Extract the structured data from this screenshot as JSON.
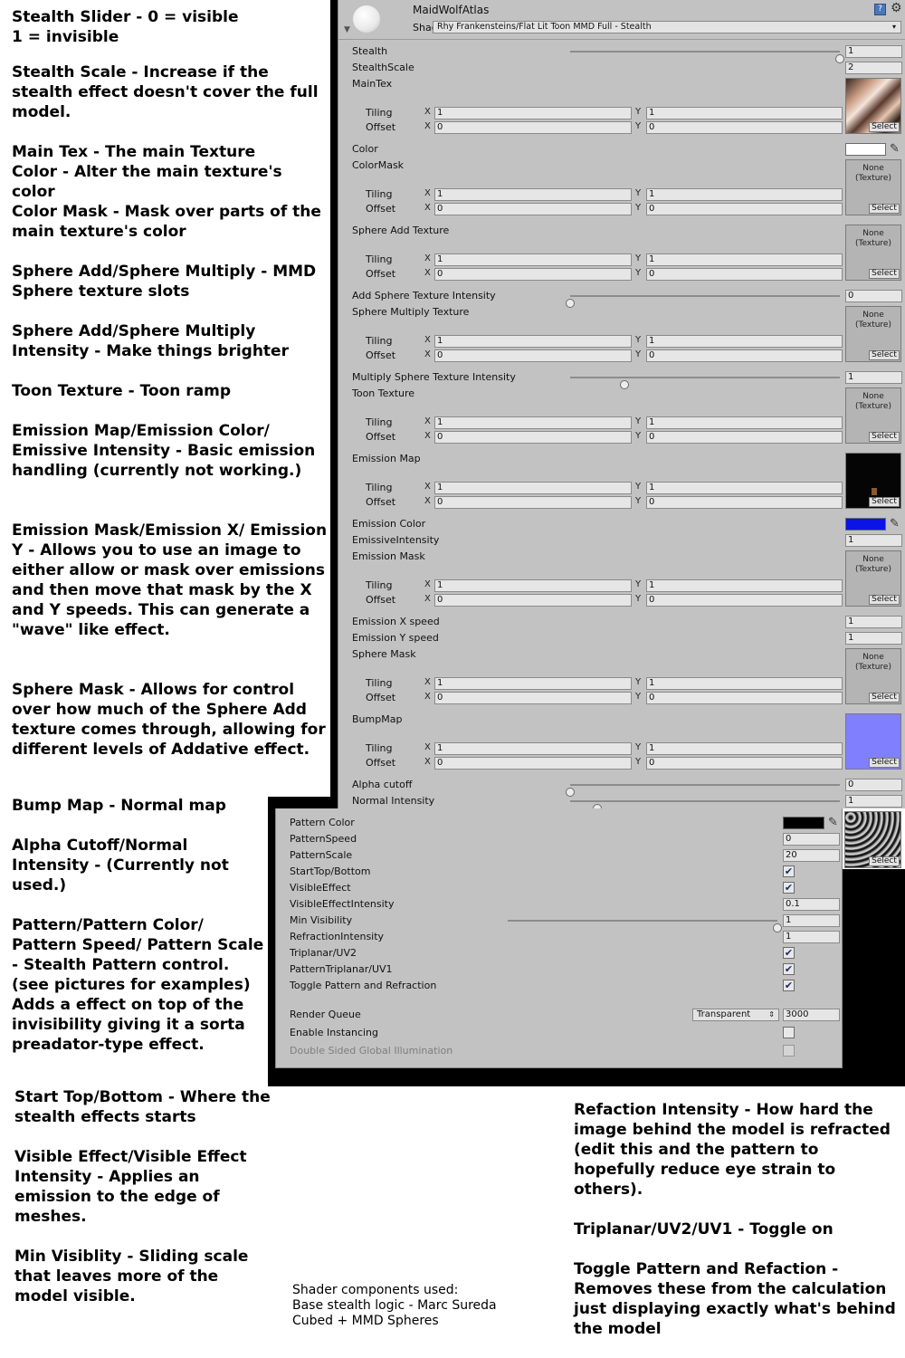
{
  "notes": {
    "n1": "Stealth Slider - 0 = visible\n                   1 = invisible",
    "n2": "Stealth Scale - Increase if the stealth effect doesn't cover the full model.",
    "n3": "Main Tex - The main Texture\nColor - Alter the main texture's\n            color\nColor Mask - Mask over parts of the main texture's color",
    "n4": "Sphere Add/Sphere Multiply - MMD Sphere texture slots",
    "n5": "Sphere Add/Sphere Multiply Intensity - Make things brighter",
    "n6": "Toon Texture - Toon ramp",
    "n7": "Emission Map/Emission Color/ Emissive Intensity - Basic emission handling (currently not working.)",
    "n8": "Emission Mask/Emission X/ Emission Y - Allows you to use an image to either allow or mask over emissions and then move that mask by the X and Y speeds.  This can generate a \"wave\" like effect.",
    "n9": "Sphere Mask - Allows for control over how much of the Sphere Add texture comes through, allowing for different levels of Addative effect.",
    "n10": "Bump Map - Normal map",
    "n11": "Alpha Cutoff/Normal Intensity - (Currently not used.)",
    "n12": "Pattern/Pattern Color/ Pattern Speed/ Pattern Scale - Stealth Pattern control. (see pictures for examples) Adds a effect on top of the invisibility giving it a sorta preadator-type effect.",
    "n13": "Start Top/Bottom - Where the stealth effects starts",
    "n14": "Visible Effect/Visible Effect Intensity - Applies an emission to the edge of meshes.",
    "n15": "Min Visiblity - Sliding scale that leaves more of the model visible.",
    "n16": "Refaction Intensity - How hard the image behind the model is refracted (edit this and the pattern to hopefully reduce eye strain to others).",
    "n17": "Triplanar/UV2/UV1 - Toggle on",
    "n18": "Toggle Pattern and Refaction - Removes these from the calculation just displaying exactly what's behind the model",
    "credits": "Shader components used:\nBase stealth logic - Marc Sureda\nCubed + MMD Spheres"
  },
  "inspector": {
    "material_name": "MaidWolfAtlas",
    "shader_label": "Shader",
    "shader_value": "Rhy Frankensteins/Flat Lit Toon MMD Full - Stealth",
    "help_icon": "book-help-icon",
    "gear_icon": "gear-icon",
    "tiling_label": "Tiling",
    "offset_label": "Offset",
    "x_label": "X",
    "y_label": "Y",
    "select_label": "Select",
    "none_texture": "None\n(Texture)",
    "stealth": {
      "label": "Stealth",
      "value": "1",
      "slider": 1
    },
    "stealth_scale": {
      "label": "StealthScale",
      "value": "2"
    },
    "main_tex": {
      "label": "MainTex",
      "tiling_x": "1",
      "tiling_y": "1",
      "offset_x": "0",
      "offset_y": "0"
    },
    "color": {
      "label": "Color",
      "swatch": "#ffffff"
    },
    "color_mask": {
      "label": "ColorMask",
      "tiling_x": "1",
      "tiling_y": "1",
      "offset_x": "0",
      "offset_y": "0"
    },
    "sphere_add": {
      "label": "Sphere Add Texture",
      "tiling_x": "1",
      "tiling_y": "1",
      "offset_x": "0",
      "offset_y": "0"
    },
    "add_sphere_intensity": {
      "label": "Add Sphere Texture Intensity",
      "value": "0",
      "slider": 0
    },
    "sphere_multiply": {
      "label": "Sphere Multiply Texture",
      "tiling_x": "1",
      "tiling_y": "1",
      "offset_x": "0",
      "offset_y": "0"
    },
    "multiply_sphere_intensity": {
      "label": "Multiply Sphere Texture Intensity",
      "value": "1",
      "slider": 0.2
    },
    "toon_texture": {
      "label": "Toon Texture",
      "tiling_x": "1",
      "tiling_y": "1",
      "offset_x": "0",
      "offset_y": "0"
    },
    "emission_map": {
      "label": "Emission Map",
      "tiling_x": "1",
      "tiling_y": "1",
      "offset_x": "0",
      "offset_y": "0"
    },
    "emission_color": {
      "label": "Emission Color",
      "swatch": "#0a14e6"
    },
    "emissive_intensity": {
      "label": "EmissiveIntensity",
      "value": "1"
    },
    "emission_mask": {
      "label": "Emission Mask",
      "tiling_x": "1",
      "tiling_y": "1",
      "offset_x": "0",
      "offset_y": "0"
    },
    "emission_x": {
      "label": "Emission X speed",
      "value": "1"
    },
    "emission_y": {
      "label": "Emission Y speed",
      "value": "1"
    },
    "sphere_mask": {
      "label": "Sphere Mask",
      "tiling_x": "1",
      "tiling_y": "1",
      "offset_x": "0",
      "offset_y": "0"
    },
    "bump_map": {
      "label": "BumpMap",
      "tiling_x": "1",
      "tiling_y": "1",
      "offset_x": "0",
      "offset_y": "0"
    },
    "alpha_cutoff": {
      "label": "Alpha cutoff",
      "value": "0",
      "slider": 0
    },
    "normal_intensity": {
      "label": "Normal Intensity",
      "value": "1",
      "slider": 0.1
    },
    "pattern_color": {
      "label": "Pattern Color",
      "swatch": "#000000"
    },
    "pattern_speed": {
      "label": "PatternSpeed",
      "value": "0"
    },
    "pattern_scale": {
      "label": "PatternScale",
      "value": "20"
    },
    "start_top_bottom": {
      "label": "StartTop/Bottom",
      "checked": true
    },
    "visible_effect": {
      "label": "VisibleEffect",
      "checked": true
    },
    "visible_effect_intensity": {
      "label": "VisibleEffectIntensity",
      "value": "0.1"
    },
    "min_visibility": {
      "label": "Min Visibility",
      "value": "1",
      "slider": 1
    },
    "refraction_intensity": {
      "label": "RefractionIntensity",
      "value": "1"
    },
    "triplanar": {
      "label": "Triplanar/UV2",
      "checked": true
    },
    "pattern_triplanar": {
      "label": "PatternTriplanar/UV1",
      "checked": true
    },
    "toggle_pattern": {
      "label": "Toggle Pattern and Refraction",
      "checked": true
    },
    "render_queue": {
      "label": "Render Queue",
      "dropdown": "Transparent",
      "value": "3000"
    },
    "enable_instancing": {
      "label": "Enable Instancing",
      "checked": false
    },
    "double_sided_gi": {
      "label": "Double Sided Global Illumination",
      "checked": false
    }
  }
}
